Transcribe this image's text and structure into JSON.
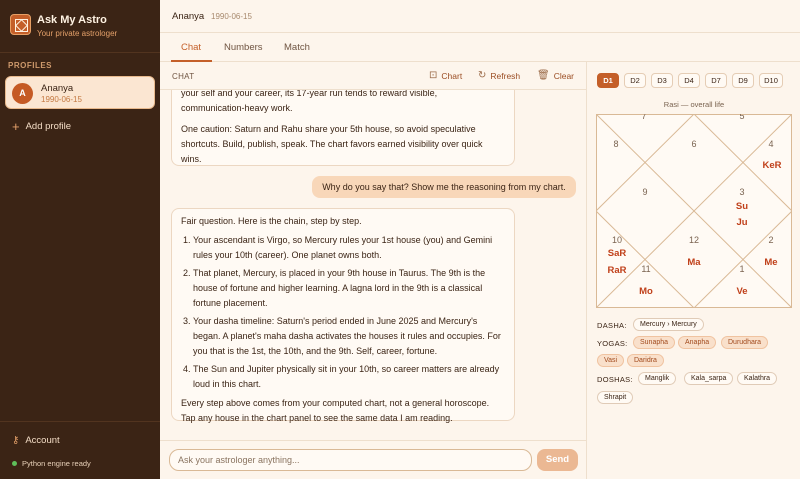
{
  "sidebar": {
    "app_title": "Ask My Astro",
    "app_subtitle": "Your private astrologer",
    "profiles_label": "PROFILES",
    "profile": {
      "initial": "A",
      "name": "Ananya",
      "date": "1990-06-15"
    },
    "add_profile": "Add profile",
    "account": "Account",
    "engine_status": "Python engine ready"
  },
  "header": {
    "name": "Ananya",
    "date": "1990-06-15"
  },
  "tabs": [
    "Chat",
    "Numbers",
    "Match"
  ],
  "chat": {
    "label": "CHAT",
    "actions": {
      "chart": "Chart",
      "refresh": "Refresh",
      "clear": "Clear"
    },
    "message1": {
      "line1": "your self and your career, its 17-year run tends to reward visible,",
      "line2": "communication-heavy work.",
      "para2": "One caution: Saturn and Rahu share your 5th house, so avoid speculative shortcuts. Build, publish, speak. The chart favors earned visibility over quick wins."
    },
    "user_message": "Why do you say that? Show me the reasoning from my chart.",
    "message2": {
      "intro": "Fair question. Here is the chain, step by step.",
      "steps": [
        "Your ascendant is Virgo, so Mercury rules your 1st house (you) and Gemini rules your 10th (career). One planet owns both.",
        "That planet, Mercury, is placed in your 9th house in Taurus. The 9th is the house of fortune and higher learning. A lagna lord in the 9th is a classical fortune placement.",
        "Your dasha timeline: Saturn's period ended in June 2025 and Mercury's began. A planet's maha dasha activates the houses it rules and occupies. For you that is the 1st, the 10th, and the 9th. Self, career, fortune.",
        "The Sun and Jupiter physically sit in your 10th, so career matters are already loud in this chart."
      ],
      "outro": "Every step above comes from your computed chart, not a general horoscope. Tap any house in the chart panel to see the same data I am reading."
    },
    "input_placeholder": "Ask your astrologer anything...",
    "send_label": "Send"
  },
  "chart_panel": {
    "divisions": [
      "D1",
      "D2",
      "D3",
      "D4",
      "D7",
      "D9",
      "D10"
    ],
    "active_division": "D1",
    "chart_title": "Rasi — overall life",
    "houses": {
      "top_cut1": "7",
      "top_cut2": "5",
      "h8": "8",
      "h6": "6",
      "h4": "4",
      "h9": "9",
      "h3": "3",
      "h10": "10",
      "h12": "12",
      "h2": "2",
      "h11": "11",
      "h1": "1"
    },
    "planets": {
      "ke_r": "KeR",
      "su": "Su",
      "ju": "Ju",
      "sa_r": "SaR",
      "ra_r": "RaR",
      "ma": "Ma",
      "me": "Me",
      "mo": "Mo",
      "ve": "Ve"
    },
    "dasha_label": "DASHA:",
    "dasha_value": "Mercury › Mercury",
    "yogas_label": "YOGAS:",
    "yogas": [
      "Sunapha",
      "Anapha",
      "Durudhara",
      "Vasi",
      "Daridra"
    ],
    "doshas_label": "DOSHAS:",
    "doshas": [
      "Manglik",
      "Kala_sarpa",
      "Kalathra",
      "Shrapit"
    ]
  },
  "colors": {
    "accent": "#c45f29",
    "sidebar_bg": "#3b2415",
    "page_bg": "#fdf5ec",
    "planet": "#c0401a"
  }
}
